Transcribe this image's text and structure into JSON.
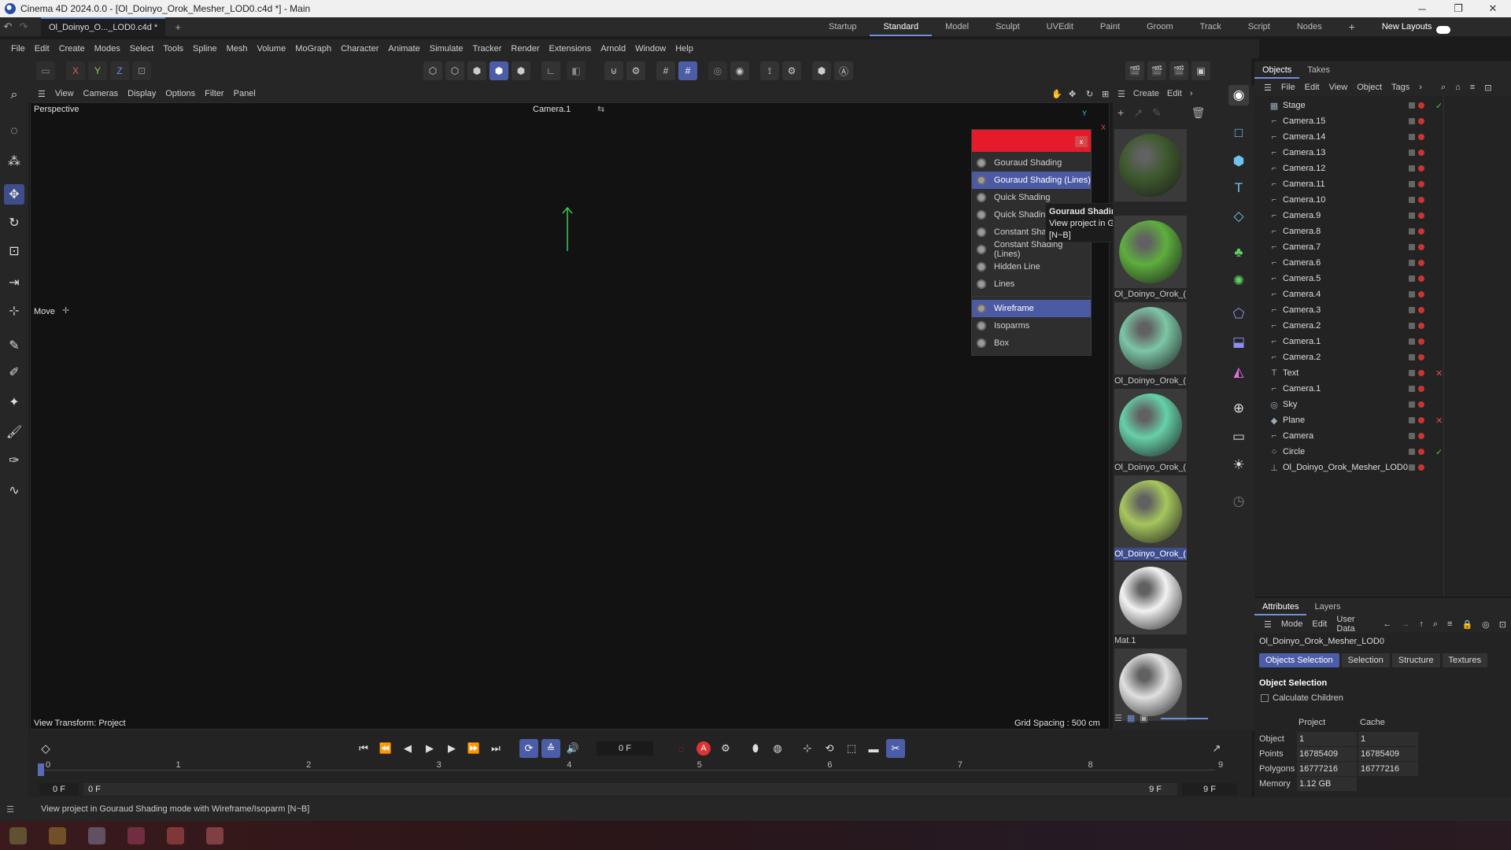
{
  "window": {
    "title": "Cinema 4D 2024.0.0 - [Ol_Doinyo_Orok_Mesher_LOD0.c4d *] - Main",
    "minimize": "─",
    "maximize": "❐",
    "close": "✕"
  },
  "tabs": {
    "document": "Ol_Doinyo_O..._LOD0.c4d *",
    "add": "+"
  },
  "layouts": [
    "Startup",
    "Standard",
    "Model",
    "Sculpt",
    "UVEdit",
    "Paint",
    "Groom",
    "Track",
    "Script",
    "Nodes"
  ],
  "layouts_active": "Standard",
  "layouts_add": "+",
  "new_layouts": "New Layouts",
  "menu": [
    "File",
    "Edit",
    "Create",
    "Modes",
    "Select",
    "Tools",
    "Spline",
    "Mesh",
    "Volume",
    "MoGraph",
    "Character",
    "Animate",
    "Simulate",
    "Tracker",
    "Render",
    "Extensions",
    "Arnold",
    "Window",
    "Help"
  ],
  "axis_toolbar": {
    "x": "X",
    "y": "Y",
    "z": "Z"
  },
  "viewport": {
    "menu": [
      "View",
      "Cameras",
      "Display",
      "Options",
      "Filter",
      "Panel"
    ],
    "label": "Perspective",
    "camera": "Camera.1",
    "move_label": "Move",
    "view_transform": "View Transform: Project",
    "grid_spacing": "Grid Spacing : 500 cm",
    "axis_y": "Y",
    "axis_x": "X",
    "axis_color": "#3cc85a"
  },
  "shading_popup": {
    "close": "x",
    "items": [
      {
        "label": "Gouraud Shading",
        "highlighted": false
      },
      {
        "label": "Gouraud Shading (Lines)",
        "highlighted": true
      },
      {
        "label": "Quick Shading",
        "highlighted": false
      },
      {
        "label": "Quick Shading",
        "highlighted": false
      },
      {
        "label": "Constant Shad",
        "highlighted": false
      },
      {
        "label": "Constant Shading (Lines)",
        "highlighted": false
      },
      {
        "label": "Hidden Line",
        "highlighted": false
      },
      {
        "label": "Lines",
        "highlighted": false
      }
    ],
    "items2": [
      {
        "label": "Wireframe",
        "highlighted": true
      },
      {
        "label": "Isoparms",
        "highlighted": false
      },
      {
        "label": "Box",
        "highlighted": false
      }
    ],
    "header_color": "#e51a2a",
    "highlight_color": "#4c5aa4"
  },
  "tooltip": {
    "title": "Gouraud Shading (Lines)",
    "line1": "View project in Gouraud Shading  mode with Wireframe/Isoparm",
    "line2": "[N~B]"
  },
  "materials": {
    "menu": [
      "Create",
      "Edit"
    ],
    "items": [
      {
        "label": "",
        "color": "#3e5a2e",
        "selected": false
      },
      {
        "label": "Ol_Doinyo_Orok_(",
        "color": "#5eae3e",
        "selected": false
      },
      {
        "label": "Ol_Doinyo_Orok_(",
        "color": "#7cc6a6",
        "selected": false
      },
      {
        "label": "Ol_Doinyo_Orok_(",
        "color": "#66d0a8",
        "selected": false
      },
      {
        "label": "Ol_Doinyo_Orok_(",
        "color": "#a6c65e",
        "selected": true
      },
      {
        "label": "Mat.1",
        "color": "#f2f2f2",
        "selected": false
      },
      {
        "label": "",
        "color": "#e0e0e0",
        "selected": false
      }
    ]
  },
  "objects": {
    "tabs": [
      "Objects",
      "Takes"
    ],
    "menu": [
      "File",
      "Edit",
      "View",
      "Object",
      "Tags"
    ],
    "items": [
      {
        "name": "Stage",
        "icon": "▦",
        "check": "✓"
      },
      {
        "name": "Camera.15",
        "icon": "⌐"
      },
      {
        "name": "Camera.14",
        "icon": "⌐"
      },
      {
        "name": "Camera.13",
        "icon": "⌐"
      },
      {
        "name": "Camera.12",
        "icon": "⌐"
      },
      {
        "name": "Camera.11",
        "icon": "⌐"
      },
      {
        "name": "Camera.10",
        "icon": "⌐"
      },
      {
        "name": "Camera.9",
        "icon": "⌐"
      },
      {
        "name": "Camera.8",
        "icon": "⌐"
      },
      {
        "name": "Camera.7",
        "icon": "⌐"
      },
      {
        "name": "Camera.6",
        "icon": "⌐"
      },
      {
        "name": "Camera.5",
        "icon": "⌐"
      },
      {
        "name": "Camera.4",
        "icon": "⌐"
      },
      {
        "name": "Camera.3",
        "icon": "⌐"
      },
      {
        "name": "Camera.2",
        "icon": "⌐"
      },
      {
        "name": "Camera.1",
        "icon": "⌐"
      },
      {
        "name": "Camera.2",
        "icon": "⌐"
      },
      {
        "name": "Text",
        "icon": "T",
        "check": "✕"
      },
      {
        "name": "Camera.1",
        "icon": "⌐"
      },
      {
        "name": "Sky",
        "icon": "◎"
      },
      {
        "name": "Plane",
        "icon": "◆",
        "check": "✕"
      },
      {
        "name": "Camera",
        "icon": "⌐"
      },
      {
        "name": "Circle",
        "icon": "○",
        "check": "✓"
      },
      {
        "name": "Ol_Doinyo_Orok_Mesher_LOD0",
        "icon": "⊥"
      }
    ]
  },
  "attributes": {
    "tabs": [
      "Attributes",
      "Layers"
    ],
    "menu": [
      "Mode",
      "Edit",
      "User Data"
    ],
    "object_name": "Ol_Doinyo_Orok_Mesher_LOD0",
    "buttons": [
      "Objects Selection",
      "Selection",
      "Structure",
      "Textures"
    ],
    "section": "Object Selection",
    "calc_children": "Calculate Children",
    "col_project": "Project",
    "col_cache": "Cache",
    "rows": [
      {
        "label": "Object",
        "project": "1",
        "cache": "1"
      },
      {
        "label": "Points",
        "project": "16785409",
        "cache": "16785409"
      },
      {
        "label": "Polygons",
        "project": "16777216",
        "cache": "16777216"
      },
      {
        "label": "Memory",
        "project": "1.12 GB",
        "cache": ""
      }
    ]
  },
  "timeline": {
    "frame": "0 F",
    "ticks": [
      "0",
      "1",
      "2",
      "3",
      "4",
      "5",
      "6",
      "7",
      "8",
      "9"
    ],
    "start": "0 F",
    "start2": "0 F",
    "end": "9 F",
    "end2": "9 F",
    "record": "A"
  },
  "status": {
    "text": "View project in Gouraud Shading  mode with Wireframe/Isoparm [N~B]"
  }
}
